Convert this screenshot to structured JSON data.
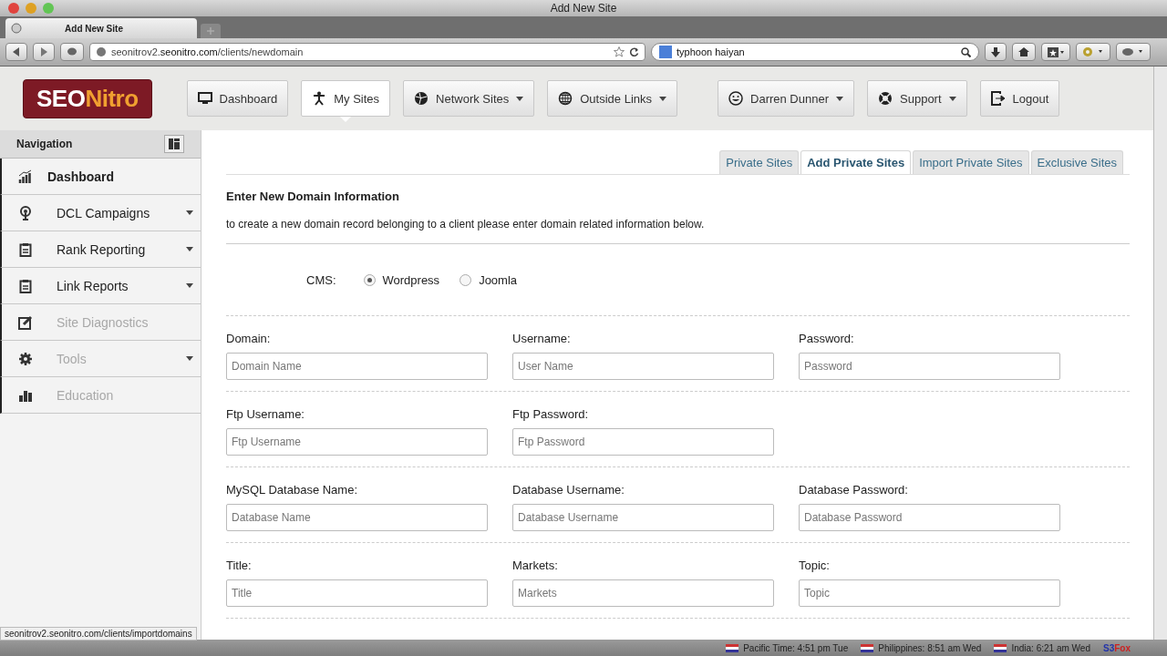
{
  "window": {
    "title": "Add New Site"
  },
  "browser": {
    "tab": "Add New Site",
    "url_host": "seonitrov2.",
    "url_domain": "seonitro.com",
    "url_path": "/clients/newdomain",
    "search": "typhoon haiyan"
  },
  "logo": {
    "part_1": "SEO",
    "part_2": "Nitro"
  },
  "top_nav": [
    {
      "label": "Dashboard",
      "caret": false,
      "selected": false
    },
    {
      "label": "My Sites",
      "caret": false,
      "selected": true
    },
    {
      "label": "Network Sites",
      "caret": true,
      "selected": false
    },
    {
      "label": "Outside Links",
      "caret": true,
      "selected": false
    },
    {
      "label": "Darren Dunner",
      "caret": true,
      "selected": false
    },
    {
      "label": "Support",
      "caret": true,
      "selected": false
    },
    {
      "label": "Logout",
      "caret": false,
      "selected": false
    }
  ],
  "sidebar": {
    "title": "Navigation",
    "items": [
      {
        "label": "Dashboard",
        "caret": false,
        "disabled": false,
        "selected": true
      },
      {
        "label": "DCL Campaigns",
        "caret": true,
        "disabled": false,
        "selected": false
      },
      {
        "label": "Rank Reporting",
        "caret": true,
        "disabled": false,
        "selected": false
      },
      {
        "label": "Link Reports",
        "caret": true,
        "disabled": false,
        "selected": false
      },
      {
        "label": "Site Diagnostics",
        "caret": false,
        "disabled": true,
        "selected": false
      },
      {
        "label": "Tools",
        "caret": true,
        "disabled": true,
        "selected": false
      },
      {
        "label": "Education",
        "caret": false,
        "disabled": true,
        "selected": false
      }
    ]
  },
  "tabs": [
    {
      "label": "Private Sites",
      "selected": false
    },
    {
      "label": "Add Private Sites",
      "selected": true
    },
    {
      "label": "Import Private Sites",
      "selected": false
    },
    {
      "label": "Exclusive Sites",
      "selected": false
    }
  ],
  "form": {
    "heading": "Enter New Domain Information",
    "description": "to create a new domain record belonging to a client please enter domain related information below.",
    "cms": {
      "label": "CMS:",
      "options": [
        {
          "label": "Wordpress",
          "selected": true
        },
        {
          "label": "Joomla",
          "selected": false
        }
      ]
    },
    "rows": [
      [
        {
          "label": "Domain:",
          "placeholder": "Domain Name"
        },
        {
          "label": "Username:",
          "placeholder": "User Name"
        },
        {
          "label": "Password:",
          "placeholder": "Password"
        }
      ],
      [
        {
          "label": "Ftp Username:",
          "placeholder": "Ftp Username"
        },
        {
          "label": "Ftp Password:",
          "placeholder": "Ftp Password"
        }
      ],
      [
        {
          "label": "MySQL Database Name:",
          "placeholder": "Database Name"
        },
        {
          "label": "Database Username:",
          "placeholder": "Database Username"
        },
        {
          "label": "Database Password:",
          "placeholder": "Database Password"
        }
      ],
      [
        {
          "label": "Title:",
          "placeholder": "Title"
        },
        {
          "label": "Markets:",
          "placeholder": "Markets"
        },
        {
          "label": "Topic:",
          "placeholder": "Topic"
        }
      ]
    ]
  },
  "link_preview": "seonitrov2.seonitro.com/clients/importdomains",
  "status_bar": {
    "clocks": [
      "Pacific Time: 4:51 pm Tue",
      "Philippines: 8:51 am Wed",
      "India: 6:21 am Wed"
    ],
    "addon_1": "S3",
    "addon_2": "Fox"
  }
}
